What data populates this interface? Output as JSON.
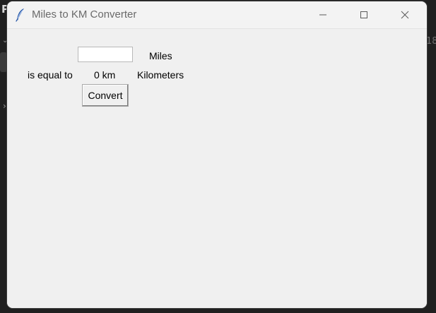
{
  "window": {
    "title": "Miles to KM Converter"
  },
  "background": {
    "letter": "P",
    "number": "18"
  },
  "form": {
    "miles_value": "",
    "miles_label": "Miles",
    "equal_label": "is equal to",
    "result_value": "0 km",
    "km_label": "Kilometers",
    "convert_label": "Convert"
  },
  "icons": {
    "app": "feather-icon",
    "minimize": "minimize-icon",
    "maximize": "maximize-icon",
    "close": "close-icon"
  },
  "colors": {
    "window_bg": "#f0f0f0",
    "titlebar_bg": "#f3f3f3",
    "desktop_bg": "#202020",
    "icon_blue": "#2a5aa8"
  }
}
